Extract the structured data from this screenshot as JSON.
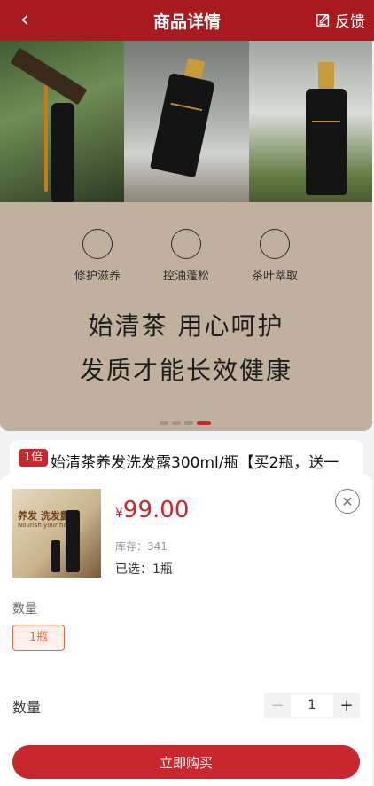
{
  "header": {
    "back_icon": "chevron-left-icon",
    "title": "商品详情",
    "feedback_label": "反馈",
    "feedback_icon": "edit-icon",
    "background_color": "#a81a1f"
  },
  "banner": {
    "features": [
      {
        "label": "修护滋养",
        "icon": "nourish-icon"
      },
      {
        "label": "控油蓬松",
        "icon": "hair-volume-icon"
      },
      {
        "label": "茶叶萃取",
        "icon": "tea-leaf-icon"
      }
    ],
    "slogan_line1": "始清茶 用心呵护",
    "slogan_line2": "发质才能长效健康",
    "carousel": {
      "total": 4,
      "active": 4
    }
  },
  "product": {
    "tag": "1倍",
    "title": "始清茶养发洗发露300ml/瓶【买2瓶，送一"
  },
  "sheet": {
    "currency": "¥",
    "price": "99.00",
    "stock_text": "库存：341",
    "selected_text": "已选：1瓶",
    "thumb_title": "养发 洗发露",
    "thumb_subtitle": "Nourish your hair",
    "close_icon": "close-icon",
    "spec_label": "数量",
    "spec_option": "1瓶",
    "quantity_label": "数量",
    "quantity_value": "1",
    "minus": "−",
    "plus": "+",
    "buy_label": "立即购买",
    "accent_color": "#c8282d"
  }
}
